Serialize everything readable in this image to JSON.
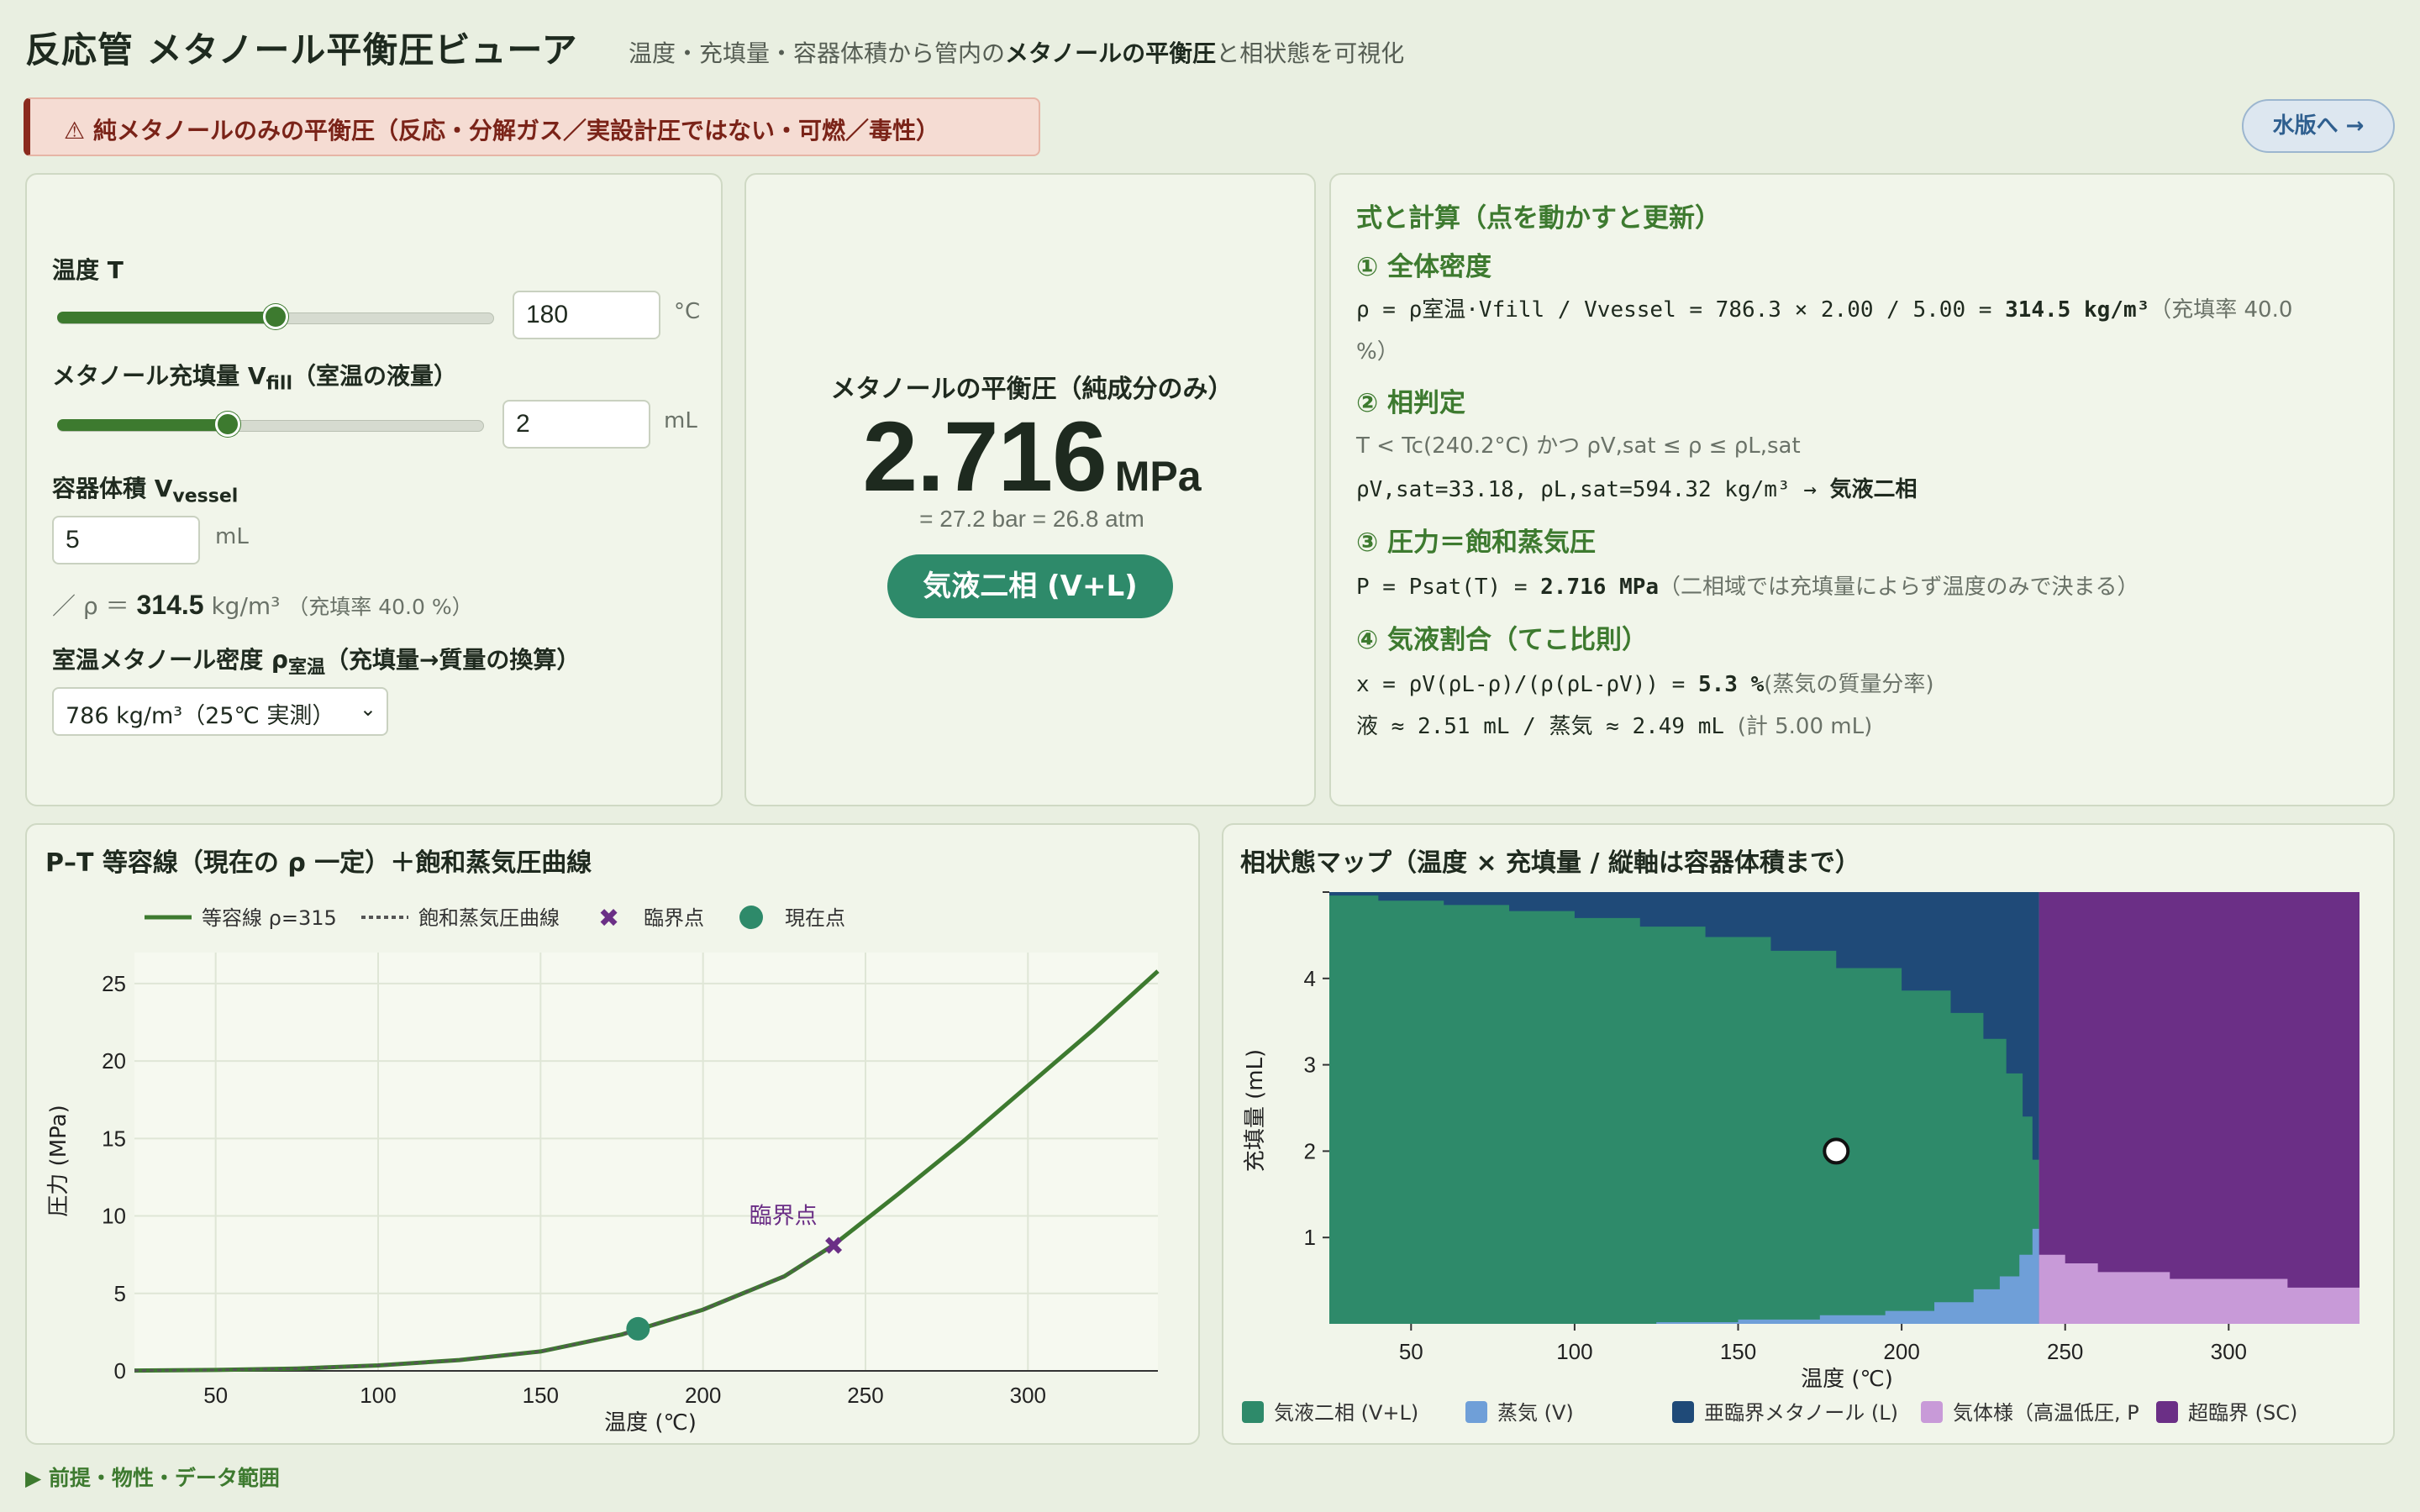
{
  "header": {
    "title": "反応管 メタノール平衡圧ビューア",
    "subtitle_pre": "温度・充填量・容器体積から管内の",
    "subtitle_bold": "メタノールの平衡圧",
    "subtitle_post": "と相状態を可視化"
  },
  "warning": "⚠ 純メタノールのみの平衡圧（反応・分解ガス／実設計圧ではない・可燃／毒性）",
  "water_button": "水版へ →",
  "inputs": {
    "temp_label": "温度 T",
    "temp_value": "180",
    "temp_unit": "°C",
    "temp_fraction": 0.5,
    "fill_label_pre": "メタノール充填量 V",
    "fill_label_sub": "fill",
    "fill_label_post": "（室温の液量）",
    "fill_value": "2",
    "fill_unit": "mL",
    "fill_fraction": 0.4,
    "vessel_label_pre": "容器体積 V",
    "vessel_label_sub": "vessel",
    "vessel_value": "5",
    "vessel_unit": "mL",
    "rho_prefix": "／ ρ ＝",
    "rho_value": "314.5",
    "rho_unit": "kg/m³",
    "rho_note": "（充填率 40.0 %）",
    "density_label_pre": "室温メタノール密度 ρ",
    "density_label_sub": "室温",
    "density_label_post": "（充填量→質量の換算）",
    "density_selected": "786 kg/m³（25℃ 実測）"
  },
  "result": {
    "label": "メタノールの平衡圧（純成分のみ）",
    "value": "2.716",
    "unit": "MPa",
    "conversion": "= 27.2 bar = 26.8 atm",
    "phase": "気液二相 (V+L)"
  },
  "formula": {
    "title": "式と計算（点を動かすと更新）",
    "s1_head": "① 全体密度",
    "s1_line": "ρ = ρ室温·Vfill / Vvessel = 786.3 × 2.00 / 5.00 = ",
    "s1_bold": "314.5 kg/m³",
    "s1_note": "（充填率 40.0",
    "s1_note2": "%）",
    "s2_head": "② 相判定",
    "s2_line1": "T < Tc(240.2°C) かつ ρV,sat ≤ ρ ≤ ρL,sat",
    "s2_line2": "ρV,sat=33.18, ρL,sat=594.32 kg/m³ → ",
    "s2_bold": "気液二相",
    "s3_head": "③ 圧力＝飽和蒸気圧",
    "s3_line": "P = Psat(T) = ",
    "s3_bold": "2.716 MPa",
    "s3_note": "（二相域では充填量によらず温度のみで決まる）",
    "s4_head": "④ 気液割合（てこ比則）",
    "s4_line1": "x = ρV(ρL-ρ)/(ρ(ρL-ρV)) = ",
    "s4_bold": "5.3 %",
    "s4_note": "(蒸気の質量分率)",
    "s4_line2": "液 ≈ 2.51 mL / 蒸気 ≈ 2.49 mL",
    "s4_note2": "(計 5.00 mL)"
  },
  "pt_chart": {
    "title": "P–T 等容線（現在の ρ 一定）＋飽和蒸気圧曲線",
    "legend": [
      "等容線 ρ=315",
      "飽和蒸気圧曲線",
      "臨界点",
      "現在点"
    ],
    "xlabel": "温度 (℃)",
    "ylabel": "圧力 (MPa)",
    "critical_label": "臨界点",
    "colors": {
      "isochore": "#3d7a2f",
      "critical": "#6b2f86",
      "current": "#2e8a6a"
    }
  },
  "chart_data": {
    "type": "line",
    "title": "P–T 等容線（現在の ρ 一定）＋飽和蒸気圧曲線",
    "xlabel": "温度 (℃)",
    "ylabel": "圧力 (MPa)",
    "xlim": [
      25,
      340
    ],
    "ylim": [
      0,
      27
    ],
    "xticks": [
      50,
      100,
      150,
      200,
      250,
      300
    ],
    "yticks": [
      0,
      5,
      10,
      15,
      20,
      25
    ],
    "series": [
      {
        "name": "等容線 ρ=315",
        "x": [
          25,
          50,
          75,
          100,
          125,
          150,
          175,
          200,
          225,
          240,
          260,
          280,
          300,
          320,
          340
        ],
        "y": [
          0.02,
          0.06,
          0.15,
          0.35,
          0.7,
          1.25,
          2.35,
          3.95,
          6.1,
          8.1,
          11.4,
          14.8,
          18.4,
          22.0,
          25.8
        ]
      },
      {
        "name": "飽和蒸気圧曲線",
        "x": [
          25,
          50,
          75,
          100,
          125,
          150,
          175,
          200,
          225,
          240
        ],
        "y": [
          0.02,
          0.06,
          0.15,
          0.35,
          0.7,
          1.25,
          2.35,
          3.95,
          6.1,
          8.1
        ]
      }
    ],
    "critical_point": {
      "x": 240.2,
      "y": 8.1
    },
    "current_point": {
      "x": 180,
      "y": 2.716
    }
  },
  "phase_map": {
    "title": "相状態マップ（温度 × 充填量 / 縦軸は容器体積まで）",
    "xlabel": "温度 (℃)",
    "ylabel": "充填量 (mL)",
    "xticks": [
      "50",
      "100",
      "150",
      "200",
      "250",
      "300"
    ],
    "yticks": [
      "1",
      "2",
      "3",
      "4"
    ],
    "legend": [
      "気液二相 (V+L)",
      "蒸気 (V)",
      "亜臨界メタノール (L)",
      "気体様（高温低圧, P",
      "超臨界 (SC)"
    ],
    "colors": [
      "#2e8a6a",
      "#6f9fd8",
      "#1f4a78",
      "#c89ad8",
      "#6b2f86"
    ],
    "current_point": {
      "T": 180,
      "fill": 2
    }
  },
  "footer": "▶ 前提・物性・データ範囲"
}
